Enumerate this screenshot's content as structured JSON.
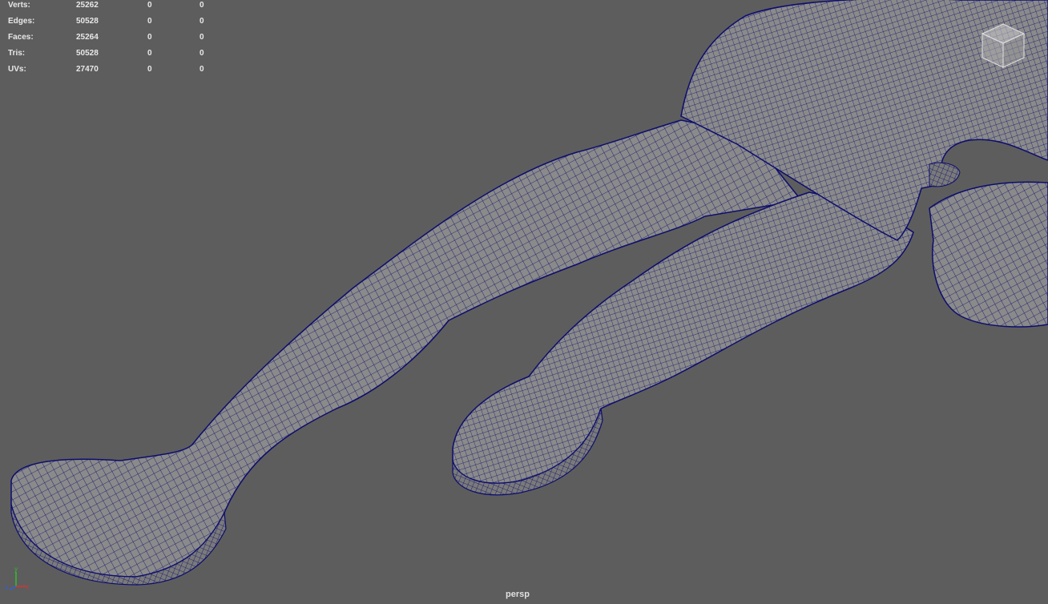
{
  "hud": {
    "rows": [
      {
        "label": "Verts:",
        "v1": "25262",
        "v2": "0",
        "v3": "0"
      },
      {
        "label": "Edges:",
        "v1": "50528",
        "v2": "0",
        "v3": "0"
      },
      {
        "label": "Faces:",
        "v1": "25264",
        "v2": "0",
        "v3": "0"
      },
      {
        "label": "Tris:",
        "v1": "50528",
        "v2": "0",
        "v3": "0"
      },
      {
        "label": "UVs:",
        "v1": "27470",
        "v2": "0",
        "v3": "0"
      }
    ]
  },
  "viewport": {
    "camera": "persp",
    "background": "#5d5d5d",
    "mesh_fill": "#8a8a8a",
    "wire_color": "#0d0d6e"
  },
  "gizmo": {
    "x_label": "x",
    "y_label": "y",
    "z_label": "z",
    "x_color": "#e03030",
    "y_color": "#30c030",
    "z_color": "#3060e0"
  },
  "icons": {
    "view_cube": "view-cube-icon",
    "axis": "axis-gizmo-icon"
  }
}
